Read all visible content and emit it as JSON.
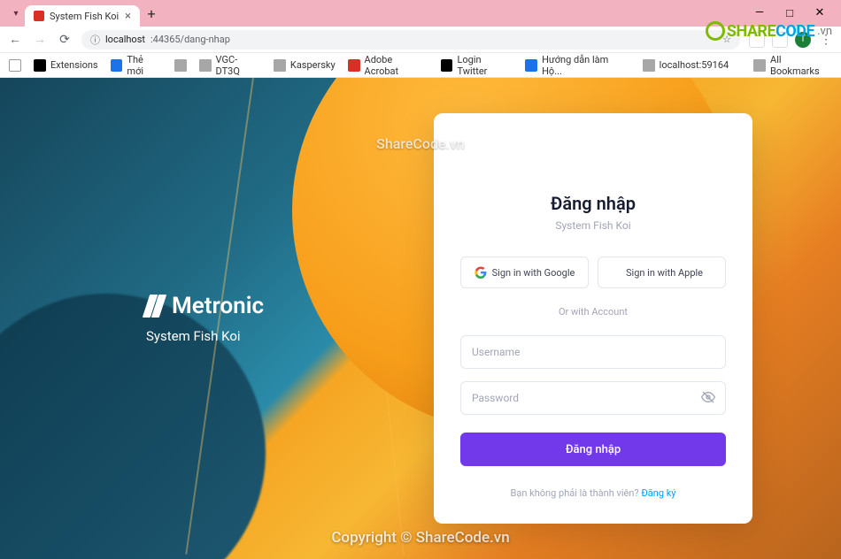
{
  "window": {
    "tab_title": "System Fish Koi",
    "minimize": "—",
    "maximize": "□",
    "close": "✕"
  },
  "urlbar": {
    "back": "←",
    "forward": "→",
    "reload": "⟳",
    "secure_icon": "ⓘ",
    "host": "localhost",
    "port_path": ":44365/dang-nhap",
    "star": "☆",
    "menu": "⋮"
  },
  "bookmarks": {
    "items": [
      {
        "label": "",
        "icon": "grid"
      },
      {
        "label": "Extensions",
        "icon": "black"
      },
      {
        "label": "Thẻ mới",
        "icon": "blue"
      },
      {
        "label": "",
        "icon": "folder"
      },
      {
        "label": "VGC-DT3Q",
        "icon": "folder"
      },
      {
        "label": "Kaspersky",
        "icon": "folder"
      },
      {
        "label": "Adobe Acrobat",
        "icon": "red"
      },
      {
        "label": "Login Twitter",
        "icon": "black"
      },
      {
        "label": "Hướng dẫn làm Hộ...",
        "icon": "blue"
      },
      {
        "label": "localhost:59164",
        "icon": "folder"
      }
    ],
    "all": "All Bookmarks"
  },
  "watermark": {
    "top_text": "ShareCode.vn",
    "bottom_text": "Copyright © ShareCode.vn",
    "logo_share": "SHARE",
    "logo_code": "CODE",
    "logo_tld": ".vn"
  },
  "brand": {
    "name": "Metronic",
    "subtitle": "System Fish Koi"
  },
  "login": {
    "title": "Đăng nhập",
    "subtitle": "System Fish Koi",
    "google_label": "Sign in with Google",
    "apple_label": "Sign in with Apple",
    "or_label": "Or with Account",
    "username_placeholder": "Username",
    "password_placeholder": "Password",
    "submit_label": "Đăng nhập",
    "signup_prompt": "Bạn không phải là thành viên? ",
    "signup_link": "Đăng ký"
  }
}
